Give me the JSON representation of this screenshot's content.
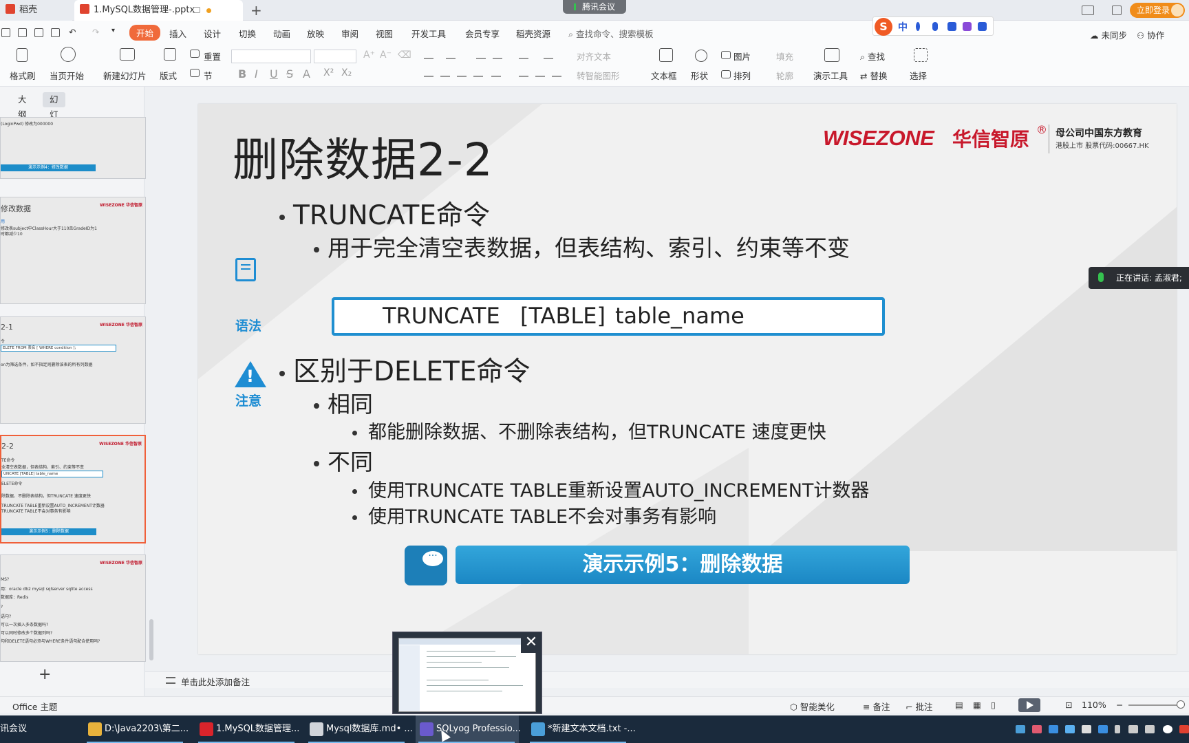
{
  "titlebar": {
    "home_tab": "稻壳",
    "doc_tab": "1.MySQL数据管理-.pptx",
    "meeting": "腾讯会议",
    "login": "立即登录"
  },
  "menu": {
    "items": [
      "开始",
      "插入",
      "设计",
      "切换",
      "动画",
      "放映",
      "审阅",
      "视图",
      "开发工具",
      "会员专享",
      "稻壳资源"
    ],
    "search": "查找命令、搜索模板",
    "sync": "未同步",
    "collab": "协作"
  },
  "ime": {
    "zh": "中"
  },
  "ribbon": {
    "format_painter": "格式刷",
    "from_current": "当页开始",
    "new_slide": "新建幻灯片",
    "layout": "版式",
    "section": "节",
    "reset": "重置",
    "align_text": "对齐文本",
    "smart_shape": "转智能图形",
    "textbox": "文本框",
    "shape": "形状",
    "picture": "图片",
    "arrange": "排列",
    "fill": "填充",
    "outline": "轮廓",
    "present_tools": "演示工具",
    "find": "查找",
    "replace": "替换",
    "select": "选择"
  },
  "leftpanel": {
    "tabs": [
      "大纲",
      "幻灯片"
    ],
    "thumbs": [
      {
        "title": "",
        "lines": [
          "(LoginPwd) 修改为000000"
        ],
        "bar": "演示示例4：修改数据"
      },
      {
        "title": "修改数据",
        "lines": [
          "用",
          "修改表subject中ClassHour大于110且GradeID为1",
          "时都减少10"
        ],
        "bar": ""
      },
      {
        "title": "2-1",
        "lines": [
          "令",
          "ELETE  FROM  表名 [ WHERE condition ];",
          "on为筛选条件，如不指定则删除该表的所有列数据"
        ],
        "bar": ""
      },
      {
        "title": "2-2",
        "lines": [
          "TE命令",
          "全清空表数据，但表结构、索引、约束等不变",
          "UNCATE  [TABLE]  table_name",
          "ELETE命令",
          "除数据、不删除表结构，但TRUNCATE 速度更快",
          "TRUNCATE TABLE重新设置AUTO_INCREMENT计数器",
          "TRUNCATE TABLE不会对事务有影响"
        ],
        "bar": "演示示例5：删除数据"
      },
      {
        "title": "",
        "lines": [
          "MS?",
          "用：oracle db2 mysql sqlserver sqlite access",
          "数据库：Redis",
          "?",
          "语句?",
          "可以一次插入多条数据吗?",
          "可以同时修改多个数据列吗?",
          "句和DELETE语句必须与WHERE条件语句配合使用吗?"
        ],
        "bar": ""
      }
    ]
  },
  "slide": {
    "title": "删除数据2-2",
    "brand_en": "WISEZONE",
    "brand_cn": "华信智原",
    "brand_reg": "®",
    "brand_r1": "母公司中国东方教育",
    "brand_r2": "港股上市 股票代码:00667.HK",
    "b1_truncate": "TRUNCATE命令",
    "b2_truncate_desc": "用于完全清空表数据，但表结构、索引、约束等不变",
    "syntax": [
      "TRUNCATE",
      "[TABLE]",
      "table_name"
    ],
    "syntax_label": "语法",
    "b1_diff": "区别于DELETE命令",
    "b2_same": "相同",
    "b3_same_desc": "都能删除数据、不删除表结构，但TRUNCATE 速度更快",
    "b2_diff": "不同",
    "b3_diff_1": "使用TRUNCATE TABLE重新设置AUTO_INCREMENT计数器",
    "b3_diff_2": "使用TRUNCATE TABLE不会对事务有影响",
    "note_label": "注意",
    "demo": "演示示例5：删除数据"
  },
  "speaking": "正在讲话: 孟淑君;",
  "notes": "单击此处添加备注",
  "status": {
    "theme": "Office 主题",
    "beautify": "智能美化",
    "remarks": "备注",
    "comments": "批注",
    "zoom": "110%"
  },
  "taskbar": {
    "items": [
      "讯会议",
      "D:\\Java2203\\第二...",
      "1.MySQL数据管理...",
      "Mysql数据库.md• ...",
      "SQLyog Professio...",
      "*新建文本文档.txt -..."
    ],
    "colors": [
      "#2e7be0",
      "#e8b23c",
      "#d9242b",
      "#d0d4da",
      "#6a5acd",
      "#4a9ed8"
    ]
  }
}
